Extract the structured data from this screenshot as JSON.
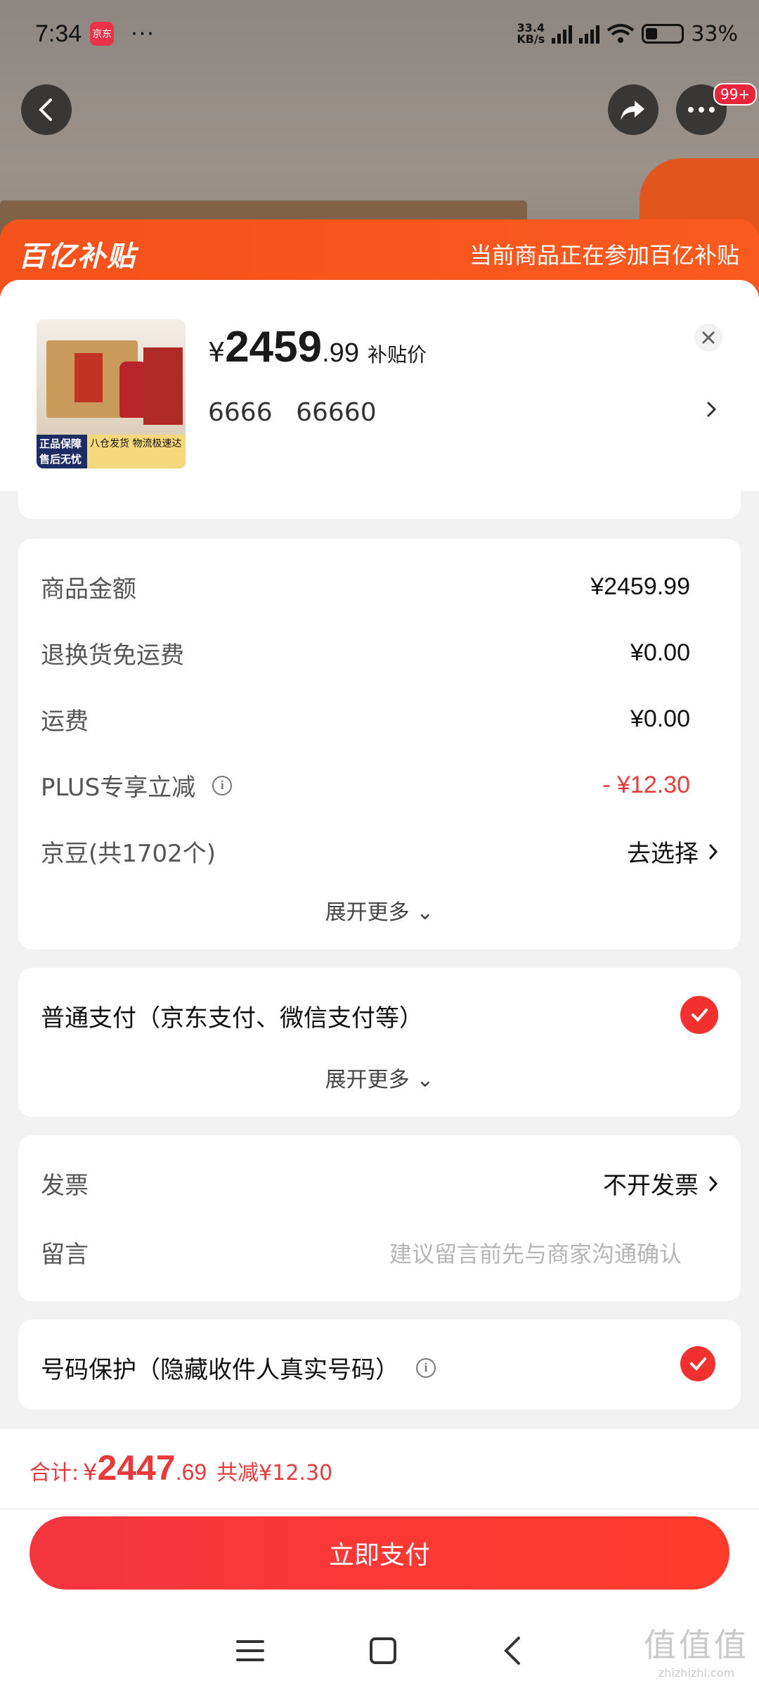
{
  "status_bar": {
    "time": "7:34",
    "app_badge": "京东",
    "dots": "···",
    "net_speed_top": "33.4",
    "net_speed_bottom": "KB/s",
    "battery": "33%"
  },
  "top_nav": {
    "message_badge": "99+"
  },
  "banner": {
    "logo": "百亿补贴",
    "text": "当前商品正在参加百亿补贴"
  },
  "product": {
    "thumb_badge_left": "正品保障 售后无忧",
    "thumb_badge_right": "八仓发货 物流极速达",
    "price_yen": "¥",
    "price_int": "2459",
    "price_dec": ".99",
    "price_tag": "补贴价",
    "sku_1": "6666",
    "sku_2": "66660"
  },
  "fees": {
    "rows": [
      {
        "label": "商品金额",
        "value": "¥2459.99"
      },
      {
        "label": "退换货免运费",
        "value": "¥0.00"
      },
      {
        "label": "运费",
        "value": "¥0.00"
      },
      {
        "label": "PLUS专享立减",
        "value": "- ¥12.30"
      },
      {
        "label": "京豆(共1702个)",
        "value": "去选择"
      }
    ],
    "expand": "展开更多"
  },
  "payment": {
    "label": "普通支付（京东支付、微信支付等）",
    "expand": "展开更多"
  },
  "invoice": {
    "invoice_label": "发票",
    "invoice_value": "不开发票",
    "message_label": "留言",
    "message_placeholder": "建议留言前先与商家沟通确认"
  },
  "protect": {
    "label": "号码保护（隐藏收件人真实号码）"
  },
  "footer": {
    "total_label": "合计:",
    "total_yen": "¥",
    "total_int": "2447",
    "total_dec": ".69",
    "total_save": "共减¥12.30",
    "pay_button": "立即支付"
  },
  "watermark": {
    "big": "值值值",
    "small": "zhizhizhi.com"
  },
  "colors": {
    "accent": "#f23030",
    "banner": "#f5521c"
  }
}
